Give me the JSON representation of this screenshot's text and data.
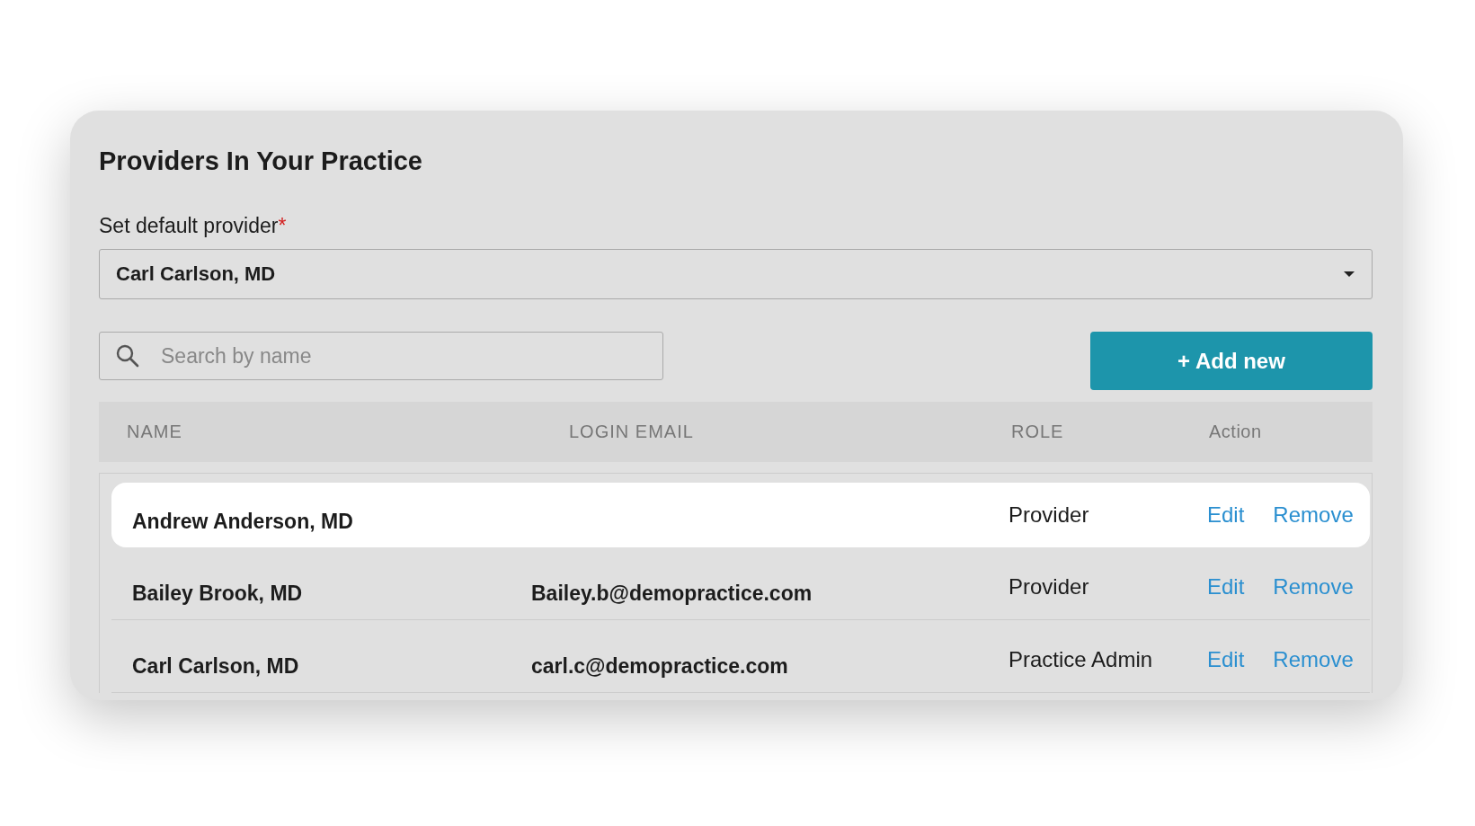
{
  "title": "Providers In Your Practice",
  "default_provider": {
    "label": "Set default provider",
    "required_mark": "*",
    "value": "Carl Carlson, MD"
  },
  "search": {
    "placeholder": "Search by name"
  },
  "add_button": "+ Add new",
  "table": {
    "columns": [
      "NAME",
      "LOGIN EMAIL",
      "ROLE",
      "Action"
    ],
    "rows": [
      {
        "name": "Andrew Anderson, MD",
        "email": "",
        "role": "Provider",
        "actions": [
          "Edit",
          "Remove"
        ],
        "selected": true
      },
      {
        "name": "Bailey Brook, MD",
        "email": "Bailey.b@demopractice.com",
        "role": "Provider",
        "actions": [
          "Edit",
          "Remove"
        ],
        "selected": false
      },
      {
        "name": "Carl Carlson, MD",
        "email": "carl.c@demopractice.com",
        "role": "Practice Admin",
        "actions": [
          "Edit",
          "Remove"
        ],
        "selected": false
      }
    ]
  }
}
